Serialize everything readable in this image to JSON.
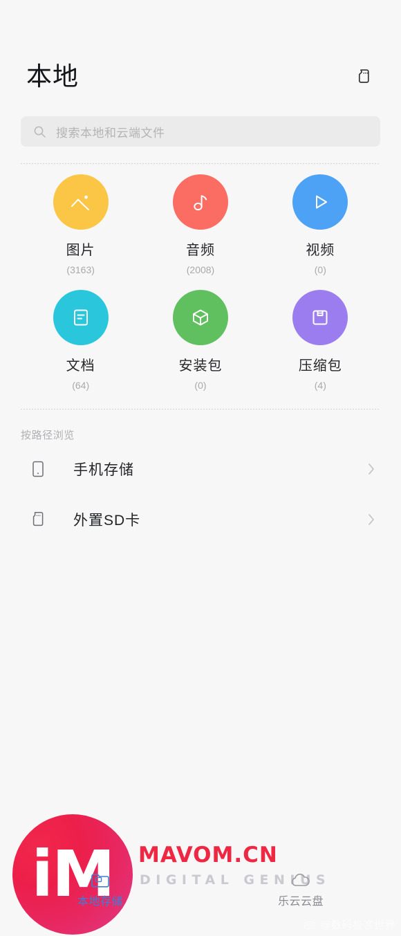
{
  "header": {
    "title": "本地",
    "sd_icon": "sd-card-icon"
  },
  "search": {
    "placeholder": "搜索本地和云端文件",
    "value": "",
    "icon": "search-icon"
  },
  "categories": [
    {
      "label": "图片",
      "count": "(3163)",
      "color": "#fbc546",
      "icon": "image-icon"
    },
    {
      "label": "音频",
      "count": "(2008)",
      "color": "#fb6c62",
      "icon": "music-note-icon"
    },
    {
      "label": "视频",
      "count": "(0)",
      "color": "#4da2f5",
      "icon": "play-triangle-icon"
    },
    {
      "label": "文档",
      "count": "(64)",
      "color": "#29c6dc",
      "icon": "document-icon"
    },
    {
      "label": "安装包",
      "count": "(0)",
      "color": "#60bf5e",
      "icon": "package-cube-icon"
    },
    {
      "label": "压缩包",
      "count": "(4)",
      "color": "#9b7df0",
      "icon": "archive-box-icon"
    }
  ],
  "path_section": {
    "heading": "按路径浏览",
    "rows": [
      {
        "label": "手机存储",
        "icon": "phone-storage-icon",
        "chevron": "chevron-right-icon"
      },
      {
        "label": "外置SD卡",
        "icon": "sd-card-icon",
        "chevron": "chevron-right-icon"
      }
    ]
  },
  "bottom_nav": {
    "items": [
      {
        "label": "本地存储",
        "icon": "folder-icon",
        "active": true
      },
      {
        "label": "乐云云盘",
        "icon": "cloud-icon",
        "active": false
      }
    ],
    "active_color": "#3e7fd4",
    "inactive_color": "#8a8a90"
  },
  "watermark": {
    "logo_text": "iM",
    "brand": "MAVOM.CN",
    "subtitle": "DIGITAL GENIUS",
    "corner_text": "@数码极客世界",
    "brand_color": "#ee2742"
  }
}
